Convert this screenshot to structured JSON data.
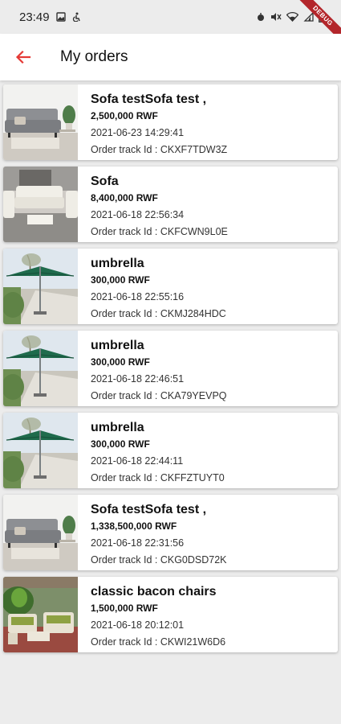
{
  "status_bar": {
    "time": "23:49",
    "debug_label": "DEBUG"
  },
  "app_bar": {
    "title": "My orders",
    "back_icon": "arrow-left-icon",
    "accent_color": "#e53935"
  },
  "orders": [
    {
      "name": "Sofa testSofa test ,",
      "price": "2,500,000 RWF",
      "date": "2021-06-23 14:29:41",
      "track": "Order track Id : CKXF7TDW3Z",
      "image": "sofa-gray"
    },
    {
      "name": "Sofa",
      "price": "8,400,000 RWF",
      "date": "2021-06-18 22:56:34",
      "track": "Order track Id : CKFCWN9L0E",
      "image": "sofa-white"
    },
    {
      "name": "umbrella",
      "price": "300,000 RWF",
      "date": "2021-06-18 22:55:16",
      "track": "Order track Id : CKMJ284HDC",
      "image": "umbrella"
    },
    {
      "name": "umbrella",
      "price": "300,000 RWF",
      "date": "2021-06-18 22:46:51",
      "track": "Order track Id : CKA79YEVPQ",
      "image": "umbrella"
    },
    {
      "name": "umbrella",
      "price": "300,000 RWF",
      "date": "2021-06-18 22:44:11",
      "track": "Order track Id : CKFFZTUYT0",
      "image": "umbrella"
    },
    {
      "name": "Sofa testSofa test ,",
      "price": "1,338,500,000 RWF",
      "date": "2021-06-18 22:31:56",
      "track": "Order track Id : CKG0DSD72K",
      "image": "sofa-gray"
    },
    {
      "name": "classic bacon chairs",
      "price": "1,500,000 RWF",
      "date": "2021-06-18 20:12:01",
      "track": "Order track Id : CKWI21W6D6",
      "image": "patio-chairs"
    }
  ]
}
